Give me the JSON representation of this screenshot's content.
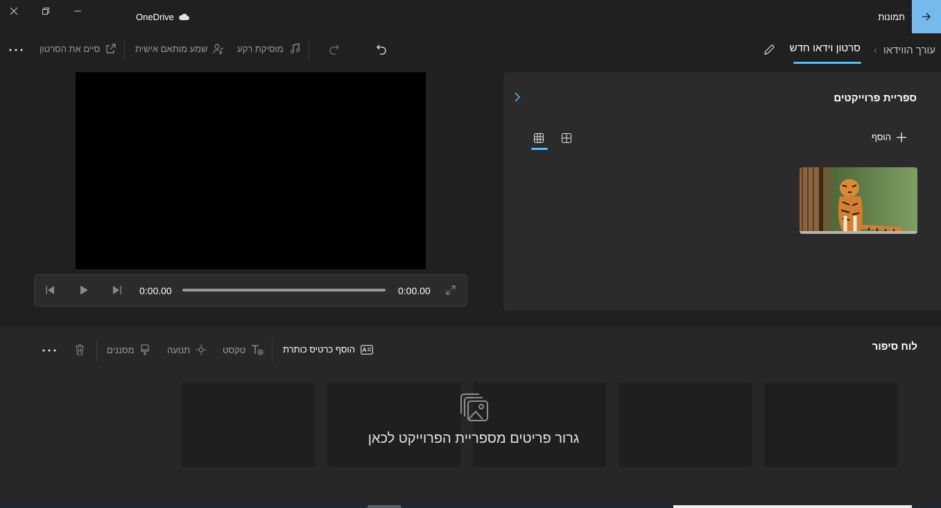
{
  "titlebar": {
    "app_name": "תמונות",
    "onedrive_label": "OneDrive"
  },
  "toolbar": {
    "breadcrumb_root": "עורך הווידאו",
    "breadcrumb_current": "סרטון וידאו חדש",
    "background_music": "מוסיקת רקע",
    "custom_audio": "שמע מותאם אישית",
    "finish_video": "סיים את הסרטון"
  },
  "player": {
    "current_time": "0:00.00",
    "duration": "0:00.00",
    "progress": 0
  },
  "library": {
    "title": "ספריית פרוייקטים",
    "add_label": "הוסף"
  },
  "storyboard": {
    "title": "לוח סיפור",
    "add_title_card": "הוסף כרטיס כותרת",
    "text": "טקסט",
    "motion": "תנועה",
    "filters": "מסננים",
    "drop_hint": "גרור פריטים מספריית הפרוייקט לכאן"
  },
  "colors": {
    "accent": "#4cc2ff",
    "back_button": "#76b9ed",
    "background": "#202020",
    "panel": "#2b2b2b"
  }
}
